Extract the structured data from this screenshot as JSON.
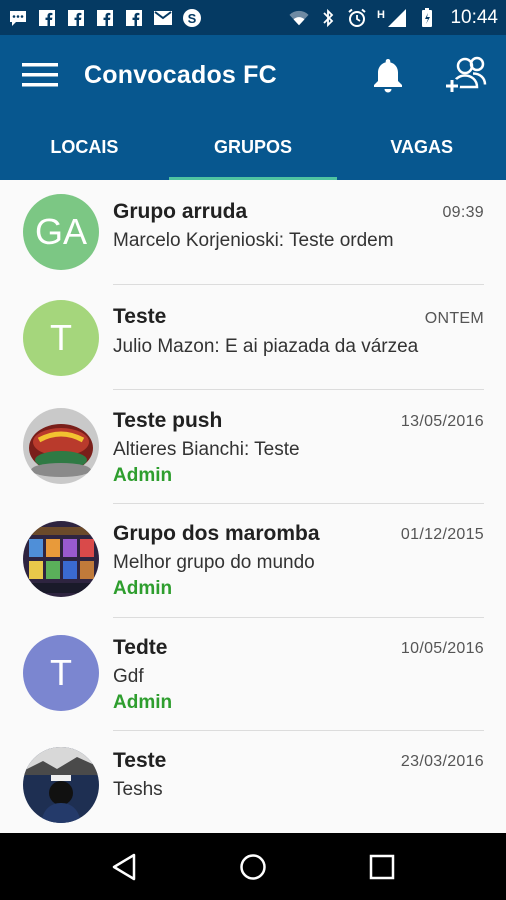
{
  "statusbar": {
    "time": "10:44",
    "left_icons": [
      "chat-icon",
      "facebook-icon",
      "facebook-icon",
      "facebook-icon",
      "facebook-icon",
      "gmail-icon",
      "skype-icon"
    ],
    "right_icons": [
      "wifi-icon",
      "bluetooth-icon",
      "alarm-icon",
      "signal-icon",
      "battery-icon"
    ],
    "network_type": "H"
  },
  "appbar": {
    "title": "Convocados FC",
    "menu_icon": "hamburger-menu-icon",
    "notifications_icon": "bell-icon",
    "add_group_icon": "add-group-icon"
  },
  "tabs": [
    {
      "label": "LOCAIS",
      "active": false
    },
    {
      "label": "GRUPOS",
      "active": true
    },
    {
      "label": "VAGAS",
      "active": false
    }
  ],
  "groups": [
    {
      "name": "Grupo arruda",
      "time": "09:39",
      "message": "Marcelo Korjenioski: Teste ordem",
      "role": "",
      "avatar_text": "GA",
      "avatar_color": "#7cc784"
    },
    {
      "name": "Teste",
      "time": "ONTEM",
      "message": "Julio Mazon: E ai piazada da várzea",
      "role": "",
      "avatar_text": "T",
      "avatar_color": "#a5d67c"
    },
    {
      "name": "Teste push",
      "time": "13/05/2016",
      "message": "Altieres Bianchi: Teste",
      "role": "Admin",
      "avatar_text": "",
      "avatar_color": "#8b2a25"
    },
    {
      "name": "Grupo dos maromba",
      "time": "01/12/2015",
      "message": "Melhor grupo do mundo",
      "role": "Admin",
      "avatar_text": "",
      "avatar_color": "#3a2a55"
    },
    {
      "name": "Tedte",
      "time": "10/05/2016",
      "message": "Gdf",
      "role": "Admin",
      "avatar_text": "T",
      "avatar_color": "#7b86d0"
    },
    {
      "name": "Teste",
      "time": "23/03/2016",
      "message": "Teshs",
      "role": "",
      "avatar_text": "",
      "avatar_color": "#1e2f52"
    }
  ],
  "navbar": {
    "back_icon": "back-triangle-icon",
    "home_icon": "home-circle-icon",
    "recents_icon": "recents-square-icon"
  }
}
